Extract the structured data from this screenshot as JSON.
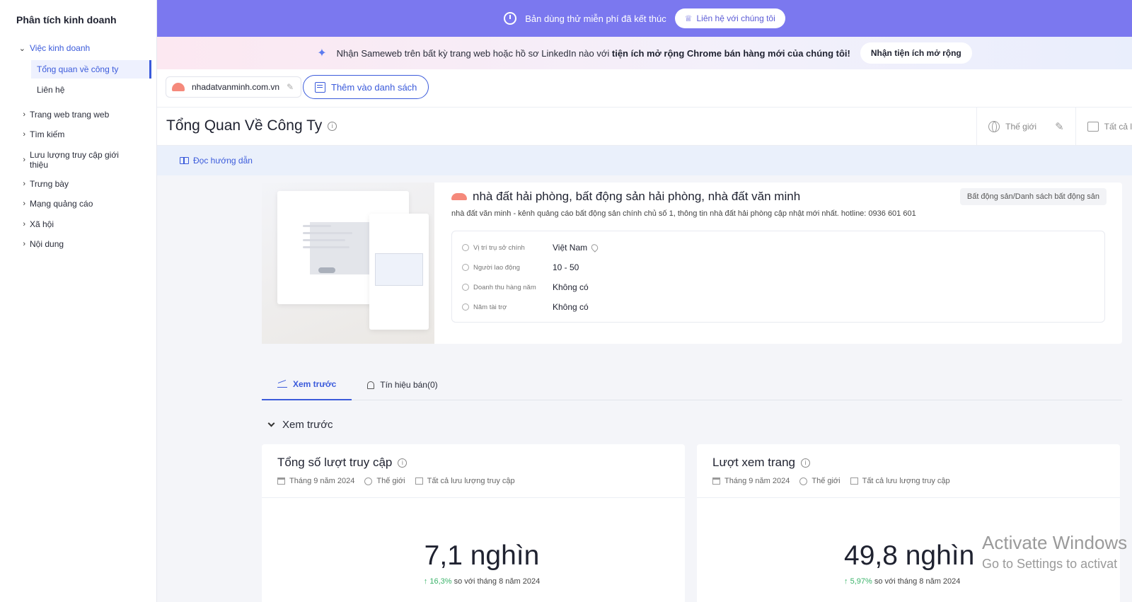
{
  "sidebar": {
    "title": "Phân tích kinh doanh",
    "group": "Việc kinh doanh",
    "subitems": [
      "Tổng quan về công ty",
      "Liên hệ"
    ],
    "items": [
      "Trang web trang web",
      "Tìm kiếm",
      "Lưu lượng truy cập giới thiệu",
      "Trưng bày",
      "Mạng quảng cáo",
      "Xã hội",
      "Nội dung"
    ]
  },
  "banner": {
    "text": "Bản dùng thử miễn phí đã kết thúc",
    "button": "Liên hệ với chúng tôi"
  },
  "extension": {
    "text_prefix": "Nhận Sameweb trên bất kỳ trang web hoặc hồ sơ LinkedIn nào với",
    "text_bold": "tiện ích mở rộng Chrome bán hàng mới của chúng tôi!",
    "button": "Nhận tiện ích mở rộng"
  },
  "domain": {
    "name": "nhadatvanminh.com.vn",
    "add_list": "Thêm vào danh sách"
  },
  "page": {
    "title": "Tổng Quan Về Công Ty",
    "region": "Thế giới",
    "traffic": "Tất cả l",
    "guide": "Đọc hướng dẫn"
  },
  "company": {
    "site_title": "nhà đất hải phòng, bất động sản hải phòng, nhà đất văn minh",
    "description": "nhà đất văn minh - kênh quảng cáo bất động sản chính chủ số 1, thông tin nhà đất hải phòng cập nhật mới nhất. hotline: 0936 601 601",
    "category": "Bất động sản/Danh sách bất động sản",
    "rows": [
      {
        "label": "Vị trí trụ sở chính",
        "value": "Việt Nam"
      },
      {
        "label": "Người lao động",
        "value": "10 - 50"
      },
      {
        "label": "Doanh thu hàng năm",
        "value": "Không có"
      },
      {
        "label": "Năm tài trợ",
        "value": "Không có"
      }
    ]
  },
  "tabs": [
    {
      "label": "Xem trước"
    },
    {
      "label": "Tín hiệu bán(0)"
    }
  ],
  "section": {
    "title": "Xem trước"
  },
  "metrics": [
    {
      "title": "Tổng số lượt truy cập",
      "period": "Tháng 9 năm 2024",
      "region": "Thế giới",
      "traffic": "Tất cả lưu lượng truy cập",
      "value": "7,1 nghìn",
      "change": "16,3%",
      "change_text": "so với tháng 8 năm 2024"
    },
    {
      "title": "Lượt xem trang",
      "period": "Tháng 9 năm 2024",
      "region": "Thế giới",
      "traffic": "Tất cả lưu lượng truy cập",
      "value": "49,8 nghìn",
      "change": "5,97%",
      "change_text": "so với tháng 8 năm 2024"
    }
  ],
  "watermark": {
    "line1": "Activate Windows",
    "line2": "Go to Settings to activat"
  },
  "colors": {
    "accent": "#3b5bdb",
    "banner": "#7b78ef",
    "positive": "#3bb36a"
  }
}
